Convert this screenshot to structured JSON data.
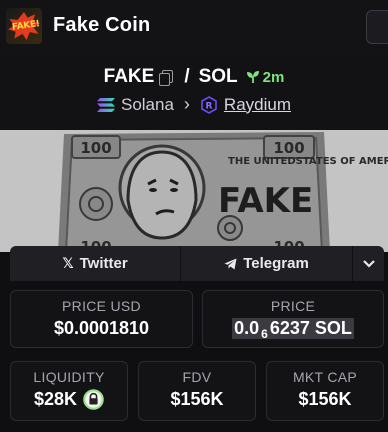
{
  "header": {
    "title": "Fake Coin",
    "logo_text": "FAKE!"
  },
  "pair": {
    "base": "FAKE",
    "separator": "/",
    "quote": "SOL",
    "age": "2m"
  },
  "chain": {
    "name": "Solana",
    "dex": "Raydium"
  },
  "banner": {
    "note_text": "FAKE",
    "note_caption": "THE UNITEDSTATES OF AMERICA",
    "corner_numbers": [
      "100",
      "100",
      "100",
      "100"
    ]
  },
  "social": {
    "twitter_label": "Twitter",
    "telegram_label": "Telegram"
  },
  "stats": {
    "price_usd": {
      "label": "PRICE USD",
      "value": "$0.0001810"
    },
    "price_native": {
      "label": "PRICE",
      "prefix": "0.0",
      "subscript": "6",
      "digits": "6237",
      "unit": "SOL"
    },
    "liquidity": {
      "label": "LIQUIDITY",
      "value": "$28K"
    },
    "fdv": {
      "label": "FDV",
      "value": "$156K"
    },
    "mkt_cap": {
      "label": "MKT CAP",
      "value": "$156K"
    }
  },
  "colors": {
    "age_green": "#7ee37a",
    "lock_green": "#9be08c",
    "card_border": "#2b2b31",
    "background": "#0f0f12"
  },
  "icons": [
    "copy-icon",
    "seedling-icon",
    "solana-icon",
    "raydium-icon",
    "x-logo-icon",
    "telegram-icon",
    "chevron-down-icon",
    "lock-icon"
  ]
}
